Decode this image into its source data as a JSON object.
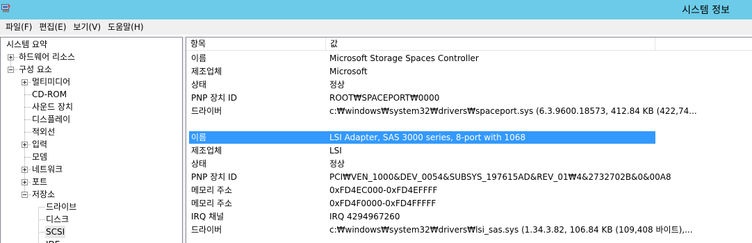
{
  "window": {
    "title": "시스템 정보"
  },
  "menu": [
    "파일(F)",
    "편집(E)",
    "보기(V)",
    "도움말(H)"
  ],
  "tree": {
    "items": [
      {
        "label": "시스템 요약",
        "depth": 0,
        "expander": "none"
      },
      {
        "label": "하드웨어 리소스",
        "depth": 1,
        "expander": "plus"
      },
      {
        "label": "구성 요소",
        "depth": 1,
        "expander": "minus"
      },
      {
        "label": "멀티미디어",
        "depth": 2,
        "expander": "plus"
      },
      {
        "label": "CD-ROM",
        "depth": 2,
        "expander": "none"
      },
      {
        "label": "사운드 장치",
        "depth": 2,
        "expander": "none"
      },
      {
        "label": "디스플레이",
        "depth": 2,
        "expander": "none"
      },
      {
        "label": "적외선",
        "depth": 2,
        "expander": "none"
      },
      {
        "label": "입력",
        "depth": 2,
        "expander": "plus"
      },
      {
        "label": "모뎀",
        "depth": 2,
        "expander": "none"
      },
      {
        "label": "네트워크",
        "depth": 2,
        "expander": "plus"
      },
      {
        "label": "포트",
        "depth": 2,
        "expander": "plus"
      },
      {
        "label": "저장소",
        "depth": 2,
        "expander": "minus"
      },
      {
        "label": "드라이브",
        "depth": 3,
        "expander": "none"
      },
      {
        "label": "디스크",
        "depth": 3,
        "expander": "none"
      },
      {
        "label": "SCSI",
        "depth": 3,
        "expander": "none",
        "selected": true
      },
      {
        "label": "IDE",
        "depth": 3,
        "expander": "none"
      }
    ]
  },
  "details": {
    "columns": [
      "항목",
      "값",
      ""
    ],
    "rows": [
      {
        "item": "이름",
        "value": "Microsoft Storage Spaces Controller"
      },
      {
        "item": "제조업체",
        "value": "Microsoft"
      },
      {
        "item": "상태",
        "value": "정상"
      },
      {
        "item": "PNP 장치 ID",
        "value": "ROOT₩SPACEPORT₩0000"
      },
      {
        "item": "드라이버",
        "value": "c:₩windows₩system32₩drivers₩spaceport.sys (6.3.9600.18573, 412.84 KB (422,74..."
      },
      {
        "item": "",
        "value": ""
      },
      {
        "item": "이름",
        "value": "LSI Adapter, SAS 3000 series, 8-port with 1068",
        "highlighted": true
      },
      {
        "item": "제조업체",
        "value": "LSI"
      },
      {
        "item": "상태",
        "value": "정상"
      },
      {
        "item": "PNP 장치 ID",
        "value": "PCI₩VEN_1000&DEV_0054&SUBSYS_197615AD&REV_01₩4&2732702B&0&00A8"
      },
      {
        "item": "메모리 주소",
        "value": "0xFD4EC000-0xFD4EFFFF"
      },
      {
        "item": "메모리 주소",
        "value": "0xFD4F0000-0xFD4FFFFF"
      },
      {
        "item": "IRQ 채널",
        "value": "IRQ 4294967260"
      },
      {
        "item": "드라이버",
        "value": "c:₩windows₩system32₩drivers₩lsi_sas.sys (1.34.3.82, 106.84 KB (109,408 바이트),..."
      }
    ]
  },
  "colors": {
    "titlebar": "#6ccbe8",
    "selection": "#3399ff",
    "tree_selection": "#e8e8e8"
  }
}
